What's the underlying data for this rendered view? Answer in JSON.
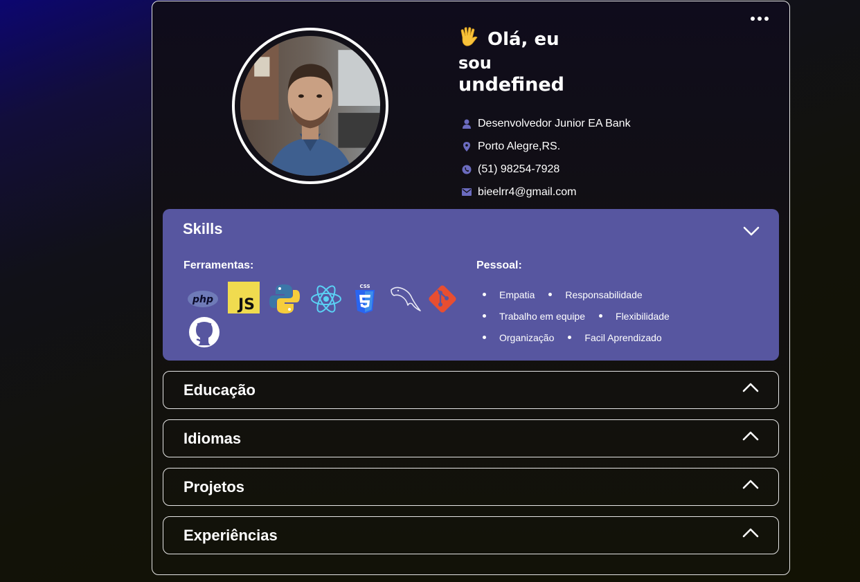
{
  "profile": {
    "greeting_emoji": "vulcan-salute",
    "greeting_line1": "Olá, eu",
    "greeting_line2": "sou",
    "name": "undefined",
    "info": [
      {
        "icon": "user-icon",
        "text": "Desenvolvedor Junior EA Bank"
      },
      {
        "icon": "location-pin-icon",
        "text": "Porto Alegre,RS."
      },
      {
        "icon": "whatsapp-icon",
        "text": "(51) 98254-7928"
      },
      {
        "icon": "envelope-icon",
        "text": "bieelrr4@gmail.com"
      }
    ]
  },
  "skills": {
    "title": "Skills",
    "tools_label": "Ferramentas:",
    "personal_label": "Pessoal:",
    "tools": [
      "php",
      "JS",
      "python",
      "react",
      "CSS",
      "mysql",
      "git",
      "github"
    ],
    "personal": [
      [
        "Empatia",
        "Responsabilidade"
      ],
      [
        "Trabalho em equipe",
        "Flexibilidade"
      ],
      [
        "Organização",
        "Facil Aprendizado"
      ]
    ]
  },
  "sections": [
    {
      "title": "Educação"
    },
    {
      "title": "Idiomas"
    },
    {
      "title": "Projetos"
    },
    {
      "title": "Experiências"
    }
  ],
  "colors": {
    "skills_panel": "#5756a0",
    "icon_accent": "#6b6bbf",
    "card_border": "#e6e6e6"
  }
}
